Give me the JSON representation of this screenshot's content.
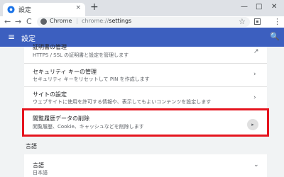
{
  "browser": {
    "tab_title": "設定",
    "tab_close": "×",
    "new_tab": "+",
    "window_minimize": "—",
    "window_maximize": "□",
    "window_close": "✕"
  },
  "toolbar": {
    "back": "←",
    "forward": "→",
    "reload": "C",
    "site_label": "Chrome",
    "separator": "|",
    "url_scheme": "chrome://",
    "url_path": "settings",
    "star": "☆",
    "menu": "⋮"
  },
  "header": {
    "menu_icon": "≡",
    "title": "設定",
    "search_icon": "🔍"
  },
  "privacy_card": {
    "rows": [
      {
        "title": "証明書の管理",
        "subtitle": "HTTPS / SSL の証明書と設定を管理します"
      },
      {
        "title": "セキュリティ キーの管理",
        "subtitle": "セキュリティ キーをリセットして PIN を作成します"
      },
      {
        "title": "サイトの設定",
        "subtitle": "ウェブサイトに使用を許可する情報や、表示してもよいコンテンツを設定します"
      },
      {
        "title": "閲覧履歴データの削除",
        "subtitle": "閲覧履歴、Cookie、キャッシュなどを削除します"
      }
    ],
    "chevron": "›",
    "external_icon": "↗",
    "arrow": "▸"
  },
  "languages_section": {
    "title": "言語",
    "row_title": "言語",
    "row_value": "日本語",
    "expand": "⌄"
  },
  "colors": {
    "header_bg": "#3c5fbf",
    "highlight": "#e5141e"
  }
}
